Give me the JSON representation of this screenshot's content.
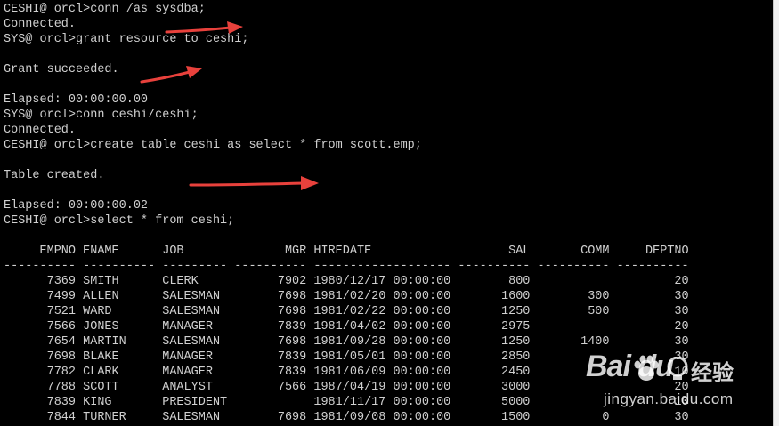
{
  "terminal": {
    "lines": [
      "CESHI@ orcl>conn /as sysdba;",
      "Connected.",
      "SYS@ orcl>grant resource to ceshi;",
      "",
      "Grant succeeded.",
      "",
      "Elapsed: 00:00:00.00",
      "SYS@ orcl>conn ceshi/ceshi;",
      "Connected.",
      "CESHI@ orcl>create table ceshi as select * from scott.emp;",
      "",
      "Table created.",
      "",
      "Elapsed: 00:00:00.02",
      "CESHI@ orcl>select * from ceshi;",
      "",
      "     EMPNO ENAME      JOB              MGR HIREDATE                   SAL       COMM     DEPTNO",
      "---------- ---------- --------- ---------- ------------------- ---------- ---------- ----------",
      "      7369 SMITH      CLERK           7902 1980/12/17 00:00:00        800                    20",
      "      7499 ALLEN      SALESMAN        7698 1981/02/20 00:00:00       1600        300         30",
      "      7521 WARD       SALESMAN        7698 1981/02/22 00:00:00       1250        500         30",
      "      7566 JONES      MANAGER         7839 1981/04/02 00:00:00       2975                    20",
      "      7654 MARTIN     SALESMAN        7698 1981/09/28 00:00:00       1250       1400         30",
      "      7698 BLAKE      MANAGER         7839 1981/05/01 00:00:00       2850                    30",
      "      7782 CLARK      MANAGER         7839 1981/06/09 00:00:00       2450                    10",
      "      7788 SCOTT      ANALYST         7566 1987/04/19 00:00:00       3000                    20",
      "      7839 KING       PRESIDENT            1981/11/17 00:00:00       5000                    10",
      "      7844 TURNER     SALESMAN        7698 1981/09/08 00:00:00       1500          0         30"
    ]
  },
  "colors": {
    "background": "#000000",
    "text": "#d0d0d0",
    "annotation_arrow": "#e8413c"
  },
  "watermark": {
    "logo_text": "Bai du",
    "chinese_text": "经验",
    "url": "jingyan.baidu.com"
  }
}
